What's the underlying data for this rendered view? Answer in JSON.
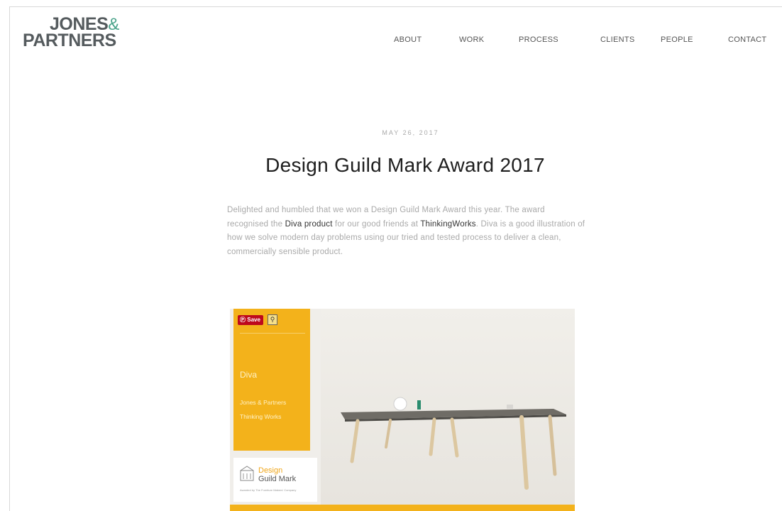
{
  "brand": {
    "line1": "JONES",
    "amp": "&",
    "line2": "PARTNERS"
  },
  "nav": {
    "items": [
      {
        "label": "ABOUT"
      },
      {
        "label": "WORK"
      },
      {
        "label": "PROCESS"
      },
      {
        "label": "CLIENTS"
      },
      {
        "label": "PEOPLE"
      },
      {
        "label": "CONTACT"
      }
    ]
  },
  "article": {
    "date": "MAY 26, 2017",
    "title": "Design Guild Mark Award 2017",
    "p1": "Delighted and humbled that we won a Design Guild Mark Award this year.  The award recognised the ",
    "link1": "Diva product",
    "p2": " for our good friends at ",
    "link2": "ThinkingWorks",
    "p3": ". Diva is a good illustration of how we solve modern day problems using our tried and tested process to deliver a clean, commercially sensible product."
  },
  "image": {
    "pin_save": "Save",
    "panel_name": "Diva",
    "panel_line1": "Jones & Partners",
    "panel_line2": "Thinking Works",
    "logo_line1": "Design",
    "logo_line2": "Guild Mark",
    "logo_small": "Awarded by The Furniture Makers' Company",
    "colors": {
      "accent_yellow": "#f3b21b",
      "pinterest_red": "#bd081c",
      "logo_green": "#4aa38a"
    }
  }
}
